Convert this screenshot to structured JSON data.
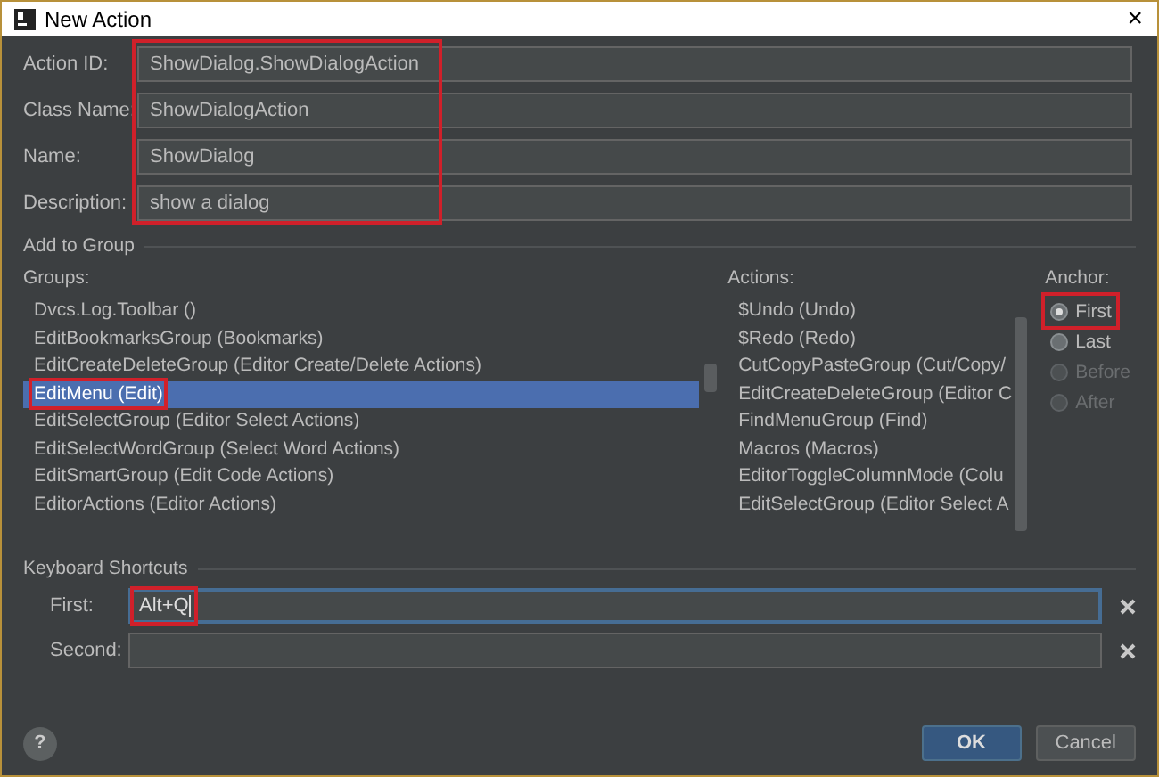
{
  "window": {
    "title": "New Action",
    "close": "×"
  },
  "fields": [
    {
      "label": "Action ID:",
      "value": "ShowDialog.ShowDialogAction"
    },
    {
      "label": "Class Name:",
      "value": "ShowDialogAction"
    },
    {
      "label": "Name:",
      "value": "ShowDialog"
    },
    {
      "label": "Description:",
      "value": "show a dialog"
    }
  ],
  "add_to_group": {
    "title": "Add to Group",
    "groups_label": "Groups:",
    "groups": [
      {
        "text": "Dvcs.Log.Toolbar ()",
        "selected": false
      },
      {
        "text": "EditBookmarksGroup (Bookmarks)",
        "selected": false
      },
      {
        "text": "EditCreateDeleteGroup (Editor Create/Delete Actions)",
        "selected": false
      },
      {
        "text": "EditMenu (Edit)",
        "selected": true
      },
      {
        "text": "EditSelectGroup (Editor Select Actions)",
        "selected": false
      },
      {
        "text": "EditSelectWordGroup (Select Word Actions)",
        "selected": false
      },
      {
        "text": "EditSmartGroup (Edit Code Actions)",
        "selected": false
      },
      {
        "text": "EditorActions (Editor Actions)",
        "selected": false
      }
    ],
    "actions_label": "Actions:",
    "actions": [
      "$Undo (Undo)",
      "$Redo (Redo)",
      "CutCopyPasteGroup (Cut/Copy/",
      "EditCreateDeleteGroup (Editor C",
      "FindMenuGroup (Find)",
      "Macros (Macros)",
      "EditorToggleColumnMode (Colu",
      "EditSelectGroup (Editor Select A"
    ],
    "anchor_label": "Anchor:",
    "anchors": [
      {
        "label": "First",
        "selected": true,
        "disabled": false
      },
      {
        "label": "Last",
        "selected": false,
        "disabled": false
      },
      {
        "label": "Before",
        "selected": false,
        "disabled": true
      },
      {
        "label": "After",
        "selected": false,
        "disabled": true
      }
    ]
  },
  "shortcuts": {
    "title": "Keyboard Shortcuts",
    "items": [
      {
        "label": "First:",
        "value": "Alt+Q",
        "focused": true
      },
      {
        "label": "Second:",
        "value": "",
        "focused": false
      }
    ]
  },
  "buttons": {
    "help": "?",
    "ok": "OK",
    "cancel": "Cancel"
  }
}
